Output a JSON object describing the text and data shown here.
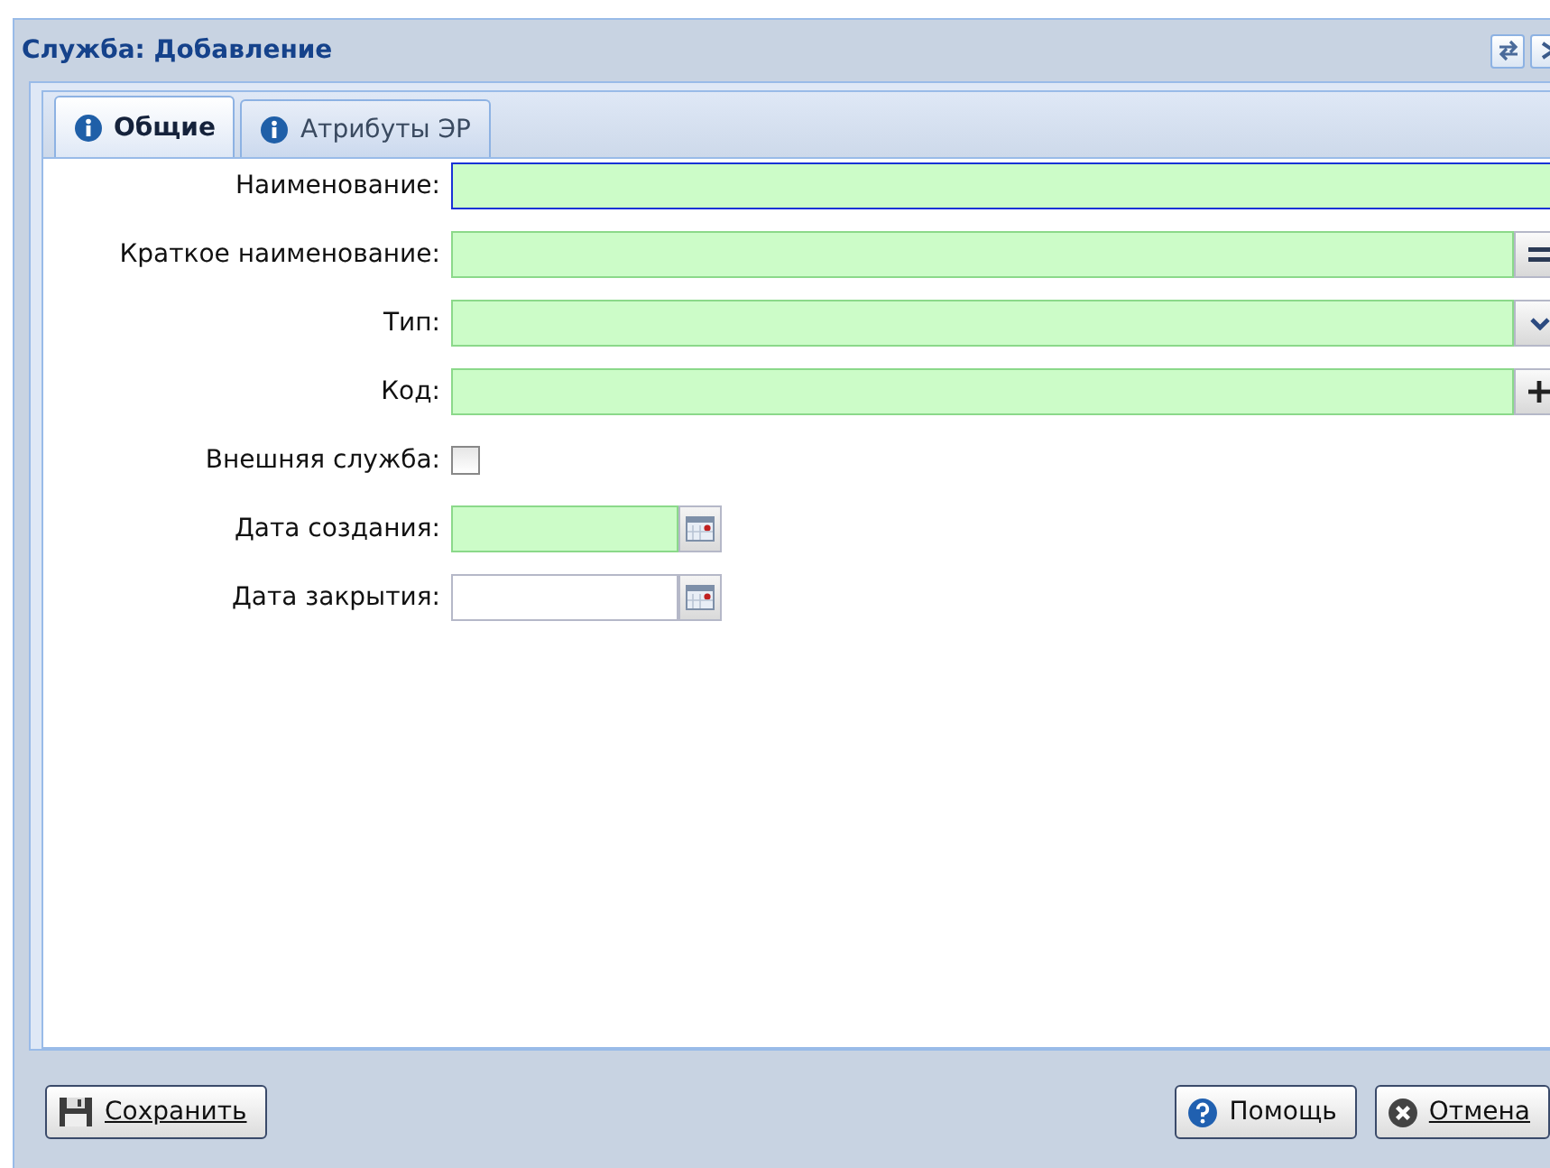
{
  "window": {
    "title": "Служба: Добавление"
  },
  "tabs": [
    {
      "label": "Общие",
      "selected": true
    },
    {
      "label": "Атрибуты ЭР",
      "selected": false
    }
  ],
  "fields": [
    {
      "label": "Наименование:",
      "kind": "text",
      "required": true,
      "focused": true
    },
    {
      "label": "Краткое наименование:",
      "kind": "picker",
      "required": true,
      "focused": false
    },
    {
      "label": "Тип:",
      "kind": "combo",
      "required": true,
      "focused": false
    },
    {
      "label": "Код:",
      "kind": "lookup",
      "required": true,
      "focused": false
    },
    {
      "label": "Внешняя служба:",
      "kind": "checkbox",
      "checked": false
    },
    {
      "label": "Дата создания:",
      "kind": "date",
      "required": true,
      "focused": false
    },
    {
      "label": "Дата закрытия:",
      "kind": "date",
      "required": false,
      "focused": false
    }
  ],
  "buttons_left": [
    {
      "label": "Сохранить",
      "kind": "save"
    }
  ],
  "buttons_right": [
    {
      "label": "Помощь",
      "kind": "help"
    },
    {
      "label": "Отмена",
      "kind": "cancel"
    }
  ]
}
